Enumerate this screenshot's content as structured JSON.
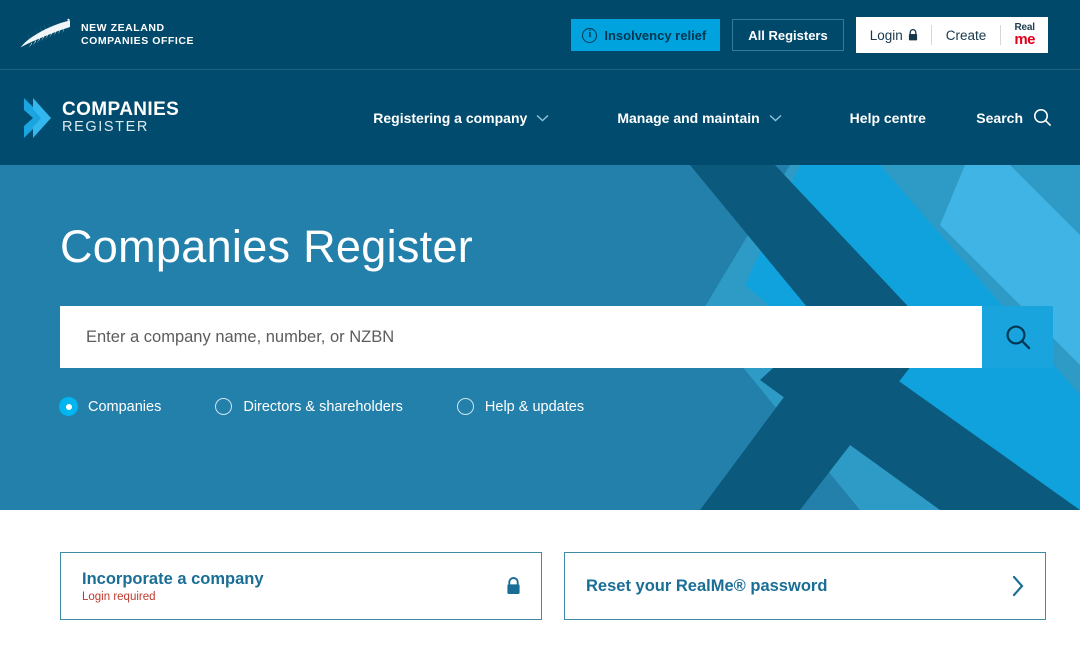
{
  "topbar": {
    "logo": {
      "icon": "silver-fern-icon",
      "line1": "NEW ZEALAND",
      "line2": "COMPANIES OFFICE"
    },
    "insolvency_button": {
      "label": "Insolvency relief",
      "icon": "info-circle-icon",
      "bg": "#00a3de",
      "fg": "#00364f"
    },
    "all_registers_button": {
      "label": "All Registers"
    },
    "login": {
      "label": "Login",
      "icon": "lock-icon"
    },
    "create": {
      "label": "Create"
    },
    "realme": {
      "line1": "Real",
      "line2": "me",
      "icon": "realme-logo"
    }
  },
  "nav": {
    "logo": {
      "icon": "chevron-right-logo-icon",
      "line1": "COMPANIES",
      "line2": "REGISTER"
    },
    "items": [
      {
        "label": "Registering a company",
        "has_chevron": true
      },
      {
        "label": "Manage and maintain",
        "has_chevron": true
      },
      {
        "label": "Help centre",
        "has_chevron": false
      }
    ],
    "search": {
      "label": "Search",
      "icon": "search-icon"
    }
  },
  "hero": {
    "title": "Companies Register",
    "search": {
      "value": "",
      "placeholder": "Enter a company name, number, or NZBN",
      "button_icon": "search-icon",
      "button_bg": "#19a4dd"
    },
    "filters": [
      {
        "label": "Companies",
        "selected": true
      },
      {
        "label": "Directors & shareholders",
        "selected": false
      },
      {
        "label": "Help & updates",
        "selected": false
      }
    ]
  },
  "cards": [
    {
      "title": "Incorporate a company",
      "subtitle": "Login required",
      "icon": "lock-icon"
    },
    {
      "title": "Reset your RealMe® password",
      "subtitle": "",
      "icon": "chevron-right-icon"
    }
  ],
  "colors": {
    "topbar_bg": "#00496b",
    "nav_bg": "#004b6e",
    "hero_bg": "#2280ab",
    "accent_cyan": "#00a3de",
    "card_title": "#1a6e96",
    "warning_red": "#c0392b"
  }
}
